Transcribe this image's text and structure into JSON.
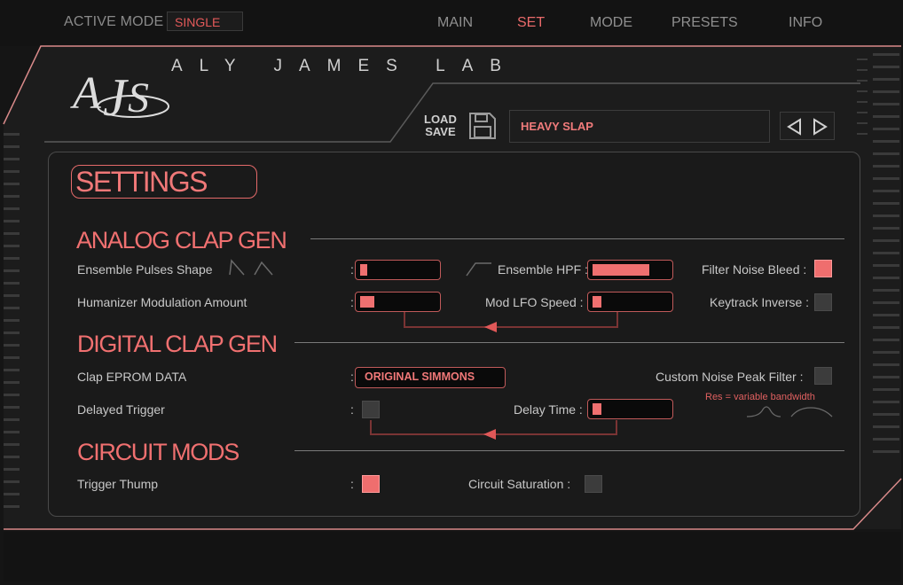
{
  "header": {
    "active_mode_label": "ACTIVE MODE :",
    "active_mode_value": "SINGLE",
    "nav": [
      {
        "label": "MAIN",
        "active": false
      },
      {
        "label": "SET",
        "active": true
      },
      {
        "label": "MODE",
        "active": false
      },
      {
        "label": "PRESETS",
        "active": false
      },
      {
        "label": "INFO",
        "active": false
      }
    ]
  },
  "brand": {
    "name": "ALY JAMES LAB",
    "logo_icon": "ajl-monogram-icon"
  },
  "preset": {
    "load_label": "LOAD",
    "save_label": "SAVE",
    "save_icon": "floppy-disk-icon",
    "name": "HEAVY SLAP",
    "prev_icon": "triangle-left-icon",
    "next_icon": "triangle-right-icon"
  },
  "settings": {
    "title": "SETTINGS",
    "analog": {
      "title": "ANALOG CLAP GEN",
      "ensemble_pulses_shape": {
        "label": "Ensemble Pulses Shape",
        "value": 0.03
      },
      "ensemble_hpf": {
        "label": "Ensemble HPF :",
        "value": 0.78
      },
      "filter_noise_bleed": {
        "label": "Filter Noise Bleed :",
        "checked": true
      },
      "humanizer_mod_amount": {
        "label": "Humanizer Modulation Amount",
        "value": 0.2
      },
      "mod_lfo_speed": {
        "label": "Mod LFO Speed :",
        "value": 0.12
      },
      "keytrack_inverse": {
        "label": "Keytrack Inverse :",
        "checked": false
      }
    },
    "digital": {
      "title": "DIGITAL CLAP GEN",
      "clap_eprom": {
        "label": "Clap EPROM DATA",
        "value": "ORIGINAL SIMMONS"
      },
      "custom_noise_peak_filter": {
        "label": "Custom Noise Peak Filter :",
        "checked": false
      },
      "res_note": "Res = variable bandwidth",
      "delayed_trigger": {
        "label": "Delayed Trigger",
        "checked": false
      },
      "delay_time": {
        "label": "Delay Time :",
        "value": 0.12
      }
    },
    "circuit": {
      "title": "CIRCUIT MODS",
      "trigger_thump": {
        "label": "Trigger Thump",
        "checked": true
      },
      "circuit_saturation": {
        "label": "Circuit Saturation  :",
        "checked": false
      }
    },
    "colon": ":"
  },
  "colors": {
    "accent": "#ef7070",
    "background": "#151515",
    "text": "#c8c8c8"
  }
}
